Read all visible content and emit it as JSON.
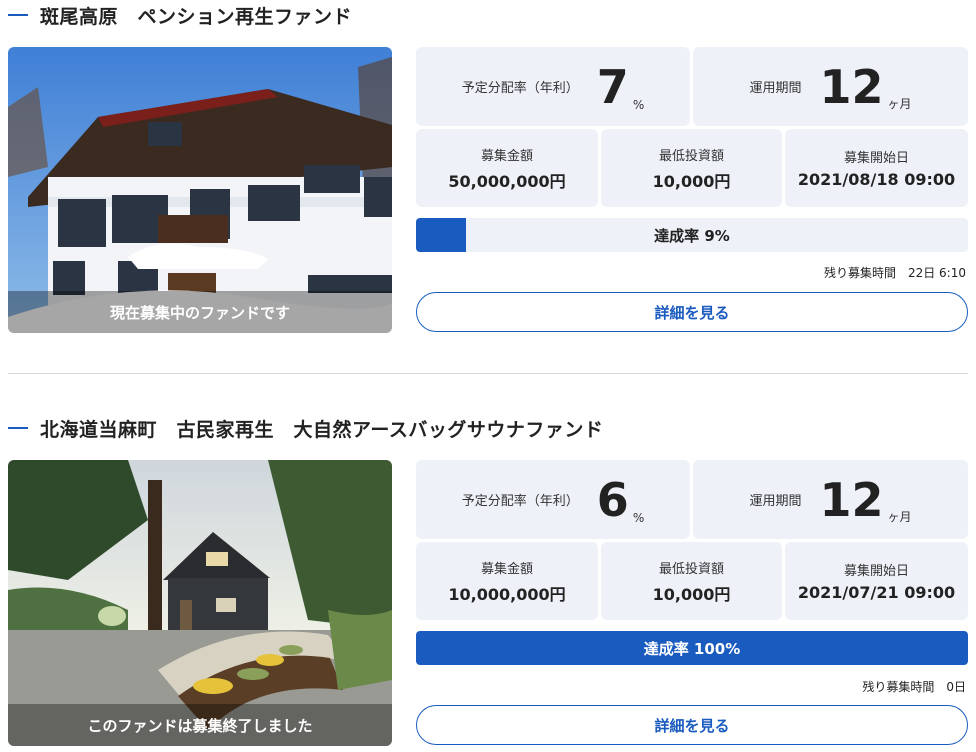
{
  "colors": {
    "accent": "#1a5bbf",
    "panel": "#eef2f8"
  },
  "funds": [
    {
      "title": "斑尾高原　ペンション再生ファンド",
      "photo_caption": "現在募集中のファンドです",
      "rate_label": "予定分配率（年利）",
      "rate_value": "7",
      "rate_unit": "%",
      "period_label": "運用期間",
      "period_value": "12",
      "period_unit": "ヶ月",
      "amount_label": "募集金額",
      "amount_value": "50,000,000円",
      "min_label": "最低投資額",
      "min_value": "10,000円",
      "start_label": "募集開始日",
      "start_value": "2021/08/18 09:00",
      "progress_text": "達成率 9%",
      "progress_percent": 9,
      "remaining": "残り募集時間　22日 6:10",
      "detail_label": "詳細を見る"
    },
    {
      "title": "北海道当麻町　古民家再生　大自然アースバッグサウナファンド",
      "photo_caption": "このファンドは募集終了しました",
      "rate_label": "予定分配率（年利）",
      "rate_value": "6",
      "rate_unit": "%",
      "period_label": "運用期間",
      "period_value": "12",
      "period_unit": "ヶ月",
      "amount_label": "募集金額",
      "amount_value": "10,000,000円",
      "min_label": "最低投資額",
      "min_value": "10,000円",
      "start_label": "募集開始日",
      "start_value": "2021/07/21 09:00",
      "progress_text": "達成率 100%",
      "progress_percent": 100,
      "remaining": "残り募集時間　0日",
      "detail_label": "詳細を見る"
    }
  ]
}
